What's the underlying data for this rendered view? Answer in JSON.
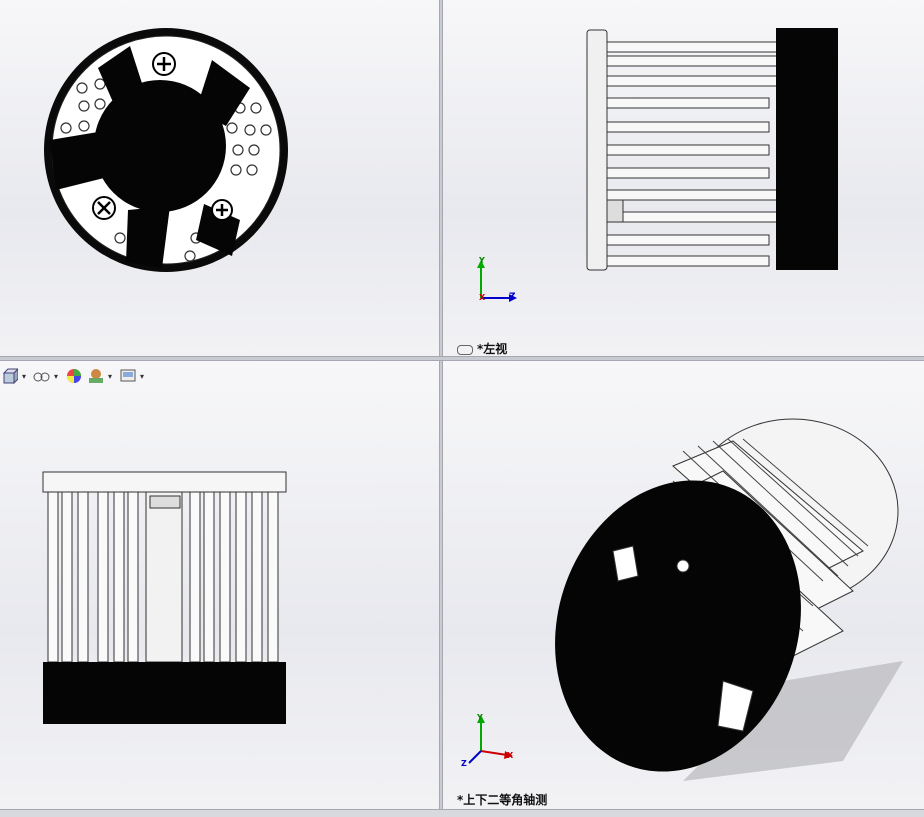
{
  "views": {
    "top_left": {
      "label": ""
    },
    "top_right": {
      "label": "*左视"
    },
    "bottom_left": {
      "label": ""
    },
    "bottom_right": {
      "label": "*上下二等角轴测"
    }
  },
  "triad": {
    "x": "X",
    "y": "Y",
    "z": "Z"
  },
  "toolbar": {
    "icons": [
      "view-orientation-icon",
      "hide-show-icon",
      "appearance-icon",
      "scene-icon",
      "view-settings-icon"
    ]
  },
  "colors": {
    "background_top": "#f7f7f9",
    "background_bottom": "#e8e9ee",
    "part_black": "#050505",
    "part_white": "#f4f4f4",
    "triad_x": "#cc0000",
    "triad_y": "#00aa00",
    "triad_z": "#0000cc"
  }
}
